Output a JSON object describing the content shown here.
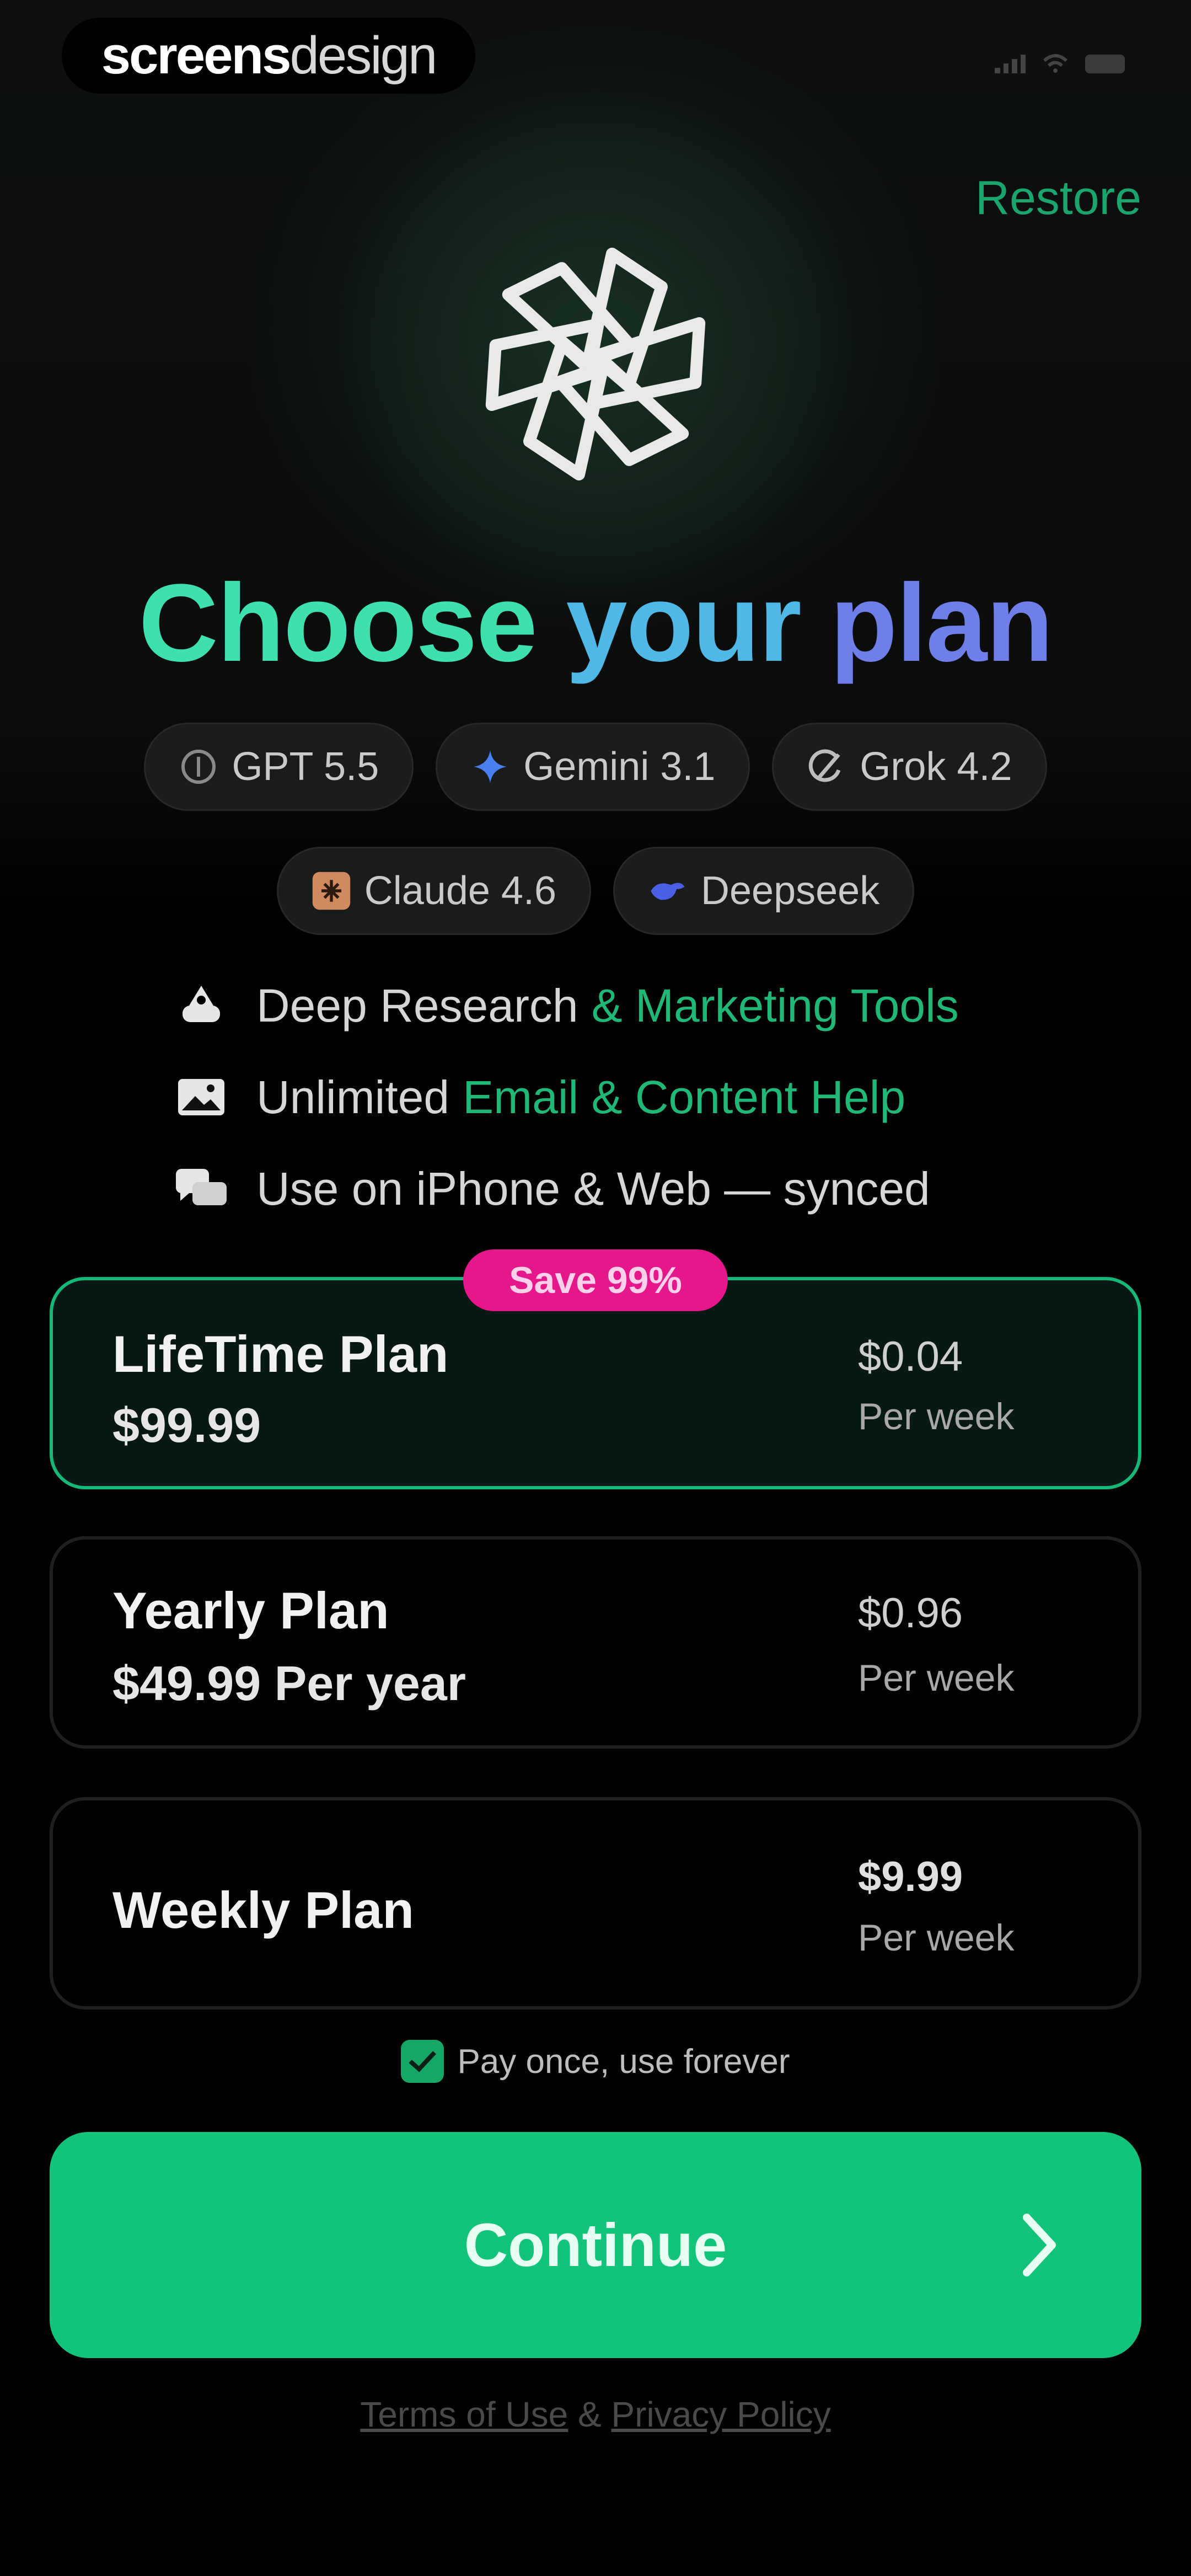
{
  "brand": {
    "part1": "screens",
    "part2": "design"
  },
  "header": {
    "restore_label": "Restore"
  },
  "title": {
    "word1": "Choose",
    "word2": "your",
    "word3": "plan"
  },
  "models": [
    {
      "label": "GPT 5.5",
      "icon": "openai-icon"
    },
    {
      "label": "Gemini 3.1",
      "icon": "gemini-icon"
    },
    {
      "label": "Grok 4.2",
      "icon": "grok-icon"
    },
    {
      "label": "Claude 4.6",
      "icon": "claude-icon"
    },
    {
      "label": "Deepseek",
      "icon": "deepseek-icon"
    }
  ],
  "features": [
    {
      "text": "Deep Research",
      "highlight": "& Marketing Tools",
      "icon": "research-icon"
    },
    {
      "text": "Unlimited",
      "highlight": "Email & Content Help",
      "icon": "image-icon"
    },
    {
      "text": "Use on iPhone & Web — synced",
      "highlight": "",
      "icon": "chat-icon"
    }
  ],
  "plans": [
    {
      "name": "LifeTime Plan",
      "price": "$99.99",
      "weekly_price": "$0.04",
      "weekly_label": "Per week",
      "badge": "Save 99%",
      "selected": true
    },
    {
      "name": "Yearly Plan",
      "price": "$49.99 Per year",
      "weekly_price": "$0.96",
      "weekly_label": "Per week",
      "selected": false
    },
    {
      "name": "Weekly Plan",
      "price": "",
      "weekly_price": "$9.99",
      "weekly_label": "Per week",
      "selected": false
    }
  ],
  "notice": {
    "text": "Pay once, use forever",
    "checked": true
  },
  "cta": {
    "label": "Continue"
  },
  "legal": {
    "terms": "Terms of Use",
    "separator": "&",
    "privacy": "Privacy Policy"
  },
  "colors": {
    "accent": "#12c47a",
    "badge": "#e5178a",
    "title_gradient": [
      "#3fe0b0",
      "#4fb8e6",
      "#6f7ee8"
    ]
  }
}
